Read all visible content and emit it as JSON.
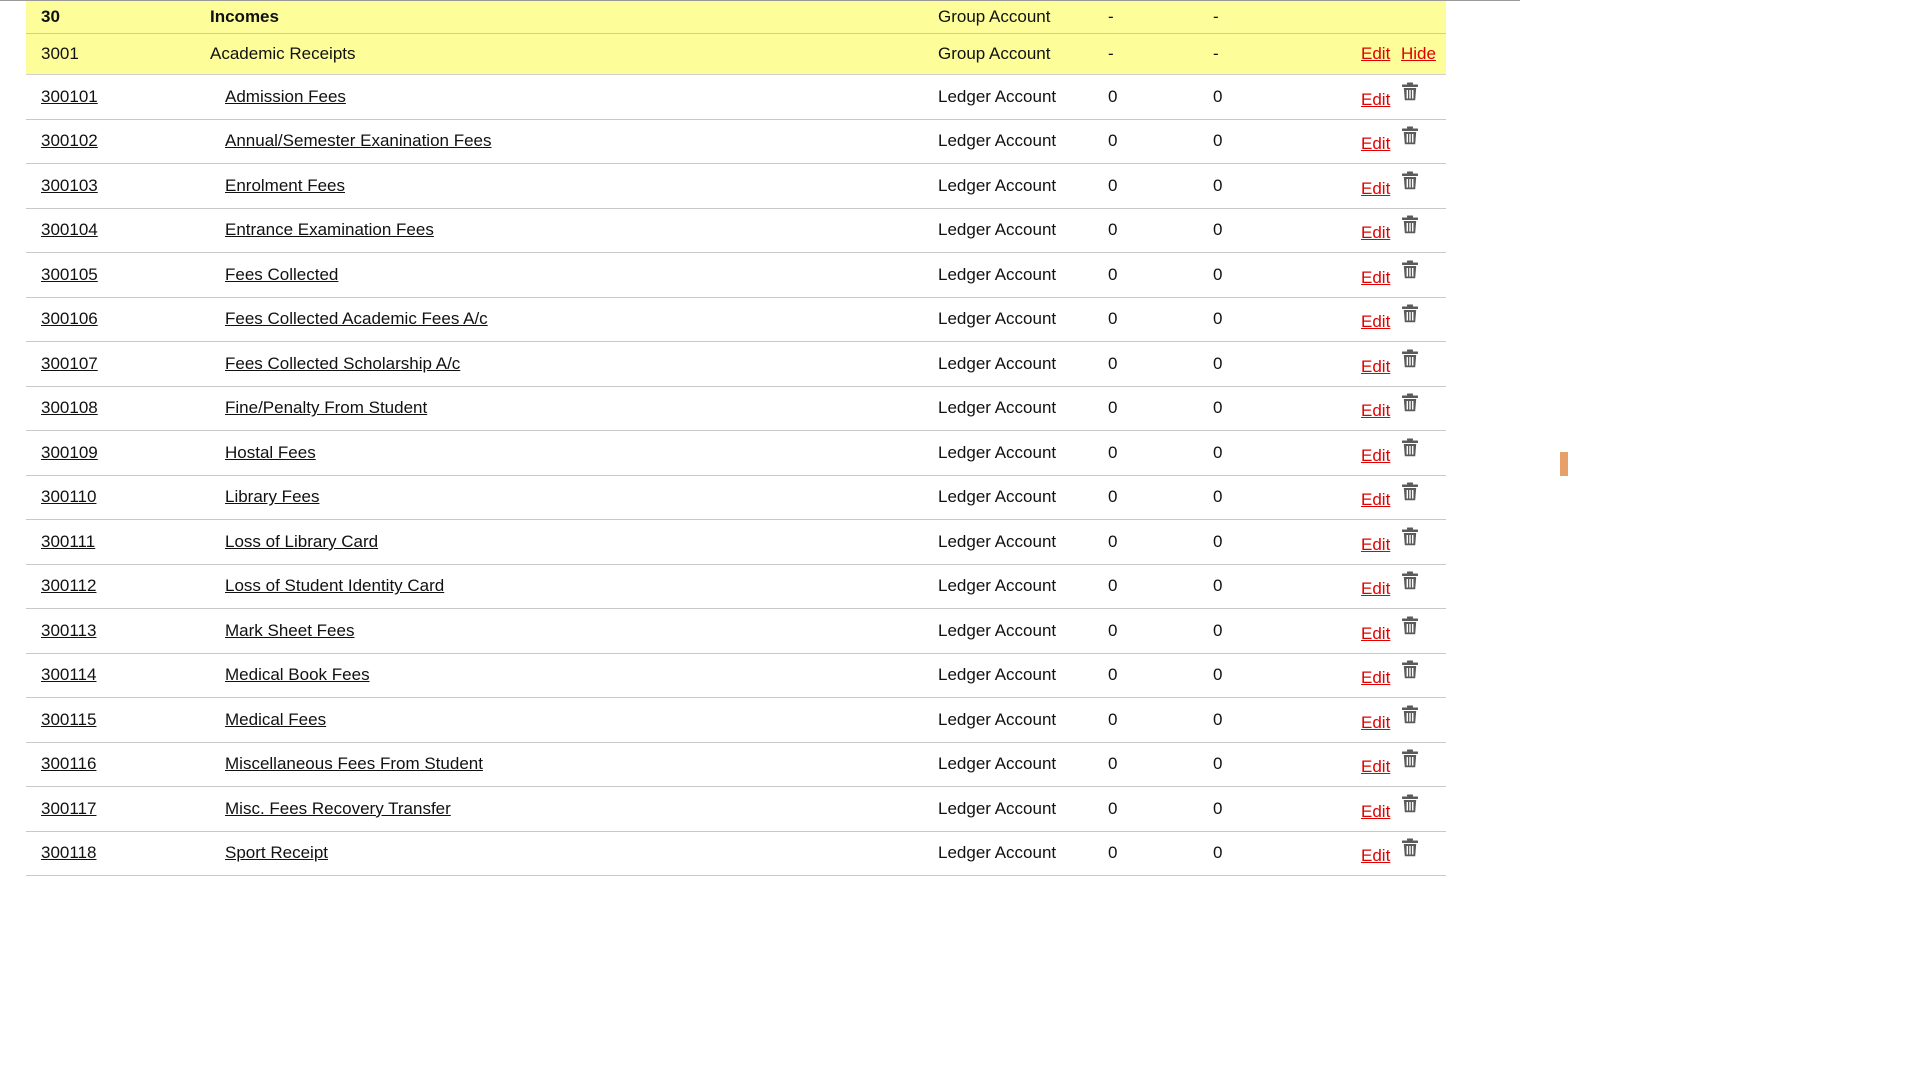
{
  "group_rows": [
    {
      "code": "30",
      "name": "Incomes",
      "type": "Group Account",
      "debit": "-",
      "credit": "-",
      "edit": "",
      "hide": ""
    },
    {
      "code": "3001",
      "name": "Academic Receipts",
      "type": "Group Account",
      "debit": "-",
      "credit": "-",
      "edit": "Edit",
      "hide": "Hide"
    }
  ],
  "ledger_rows": [
    {
      "code": "300101",
      "name": "Admission Fees",
      "type": "Ledger Account",
      "debit": "0",
      "credit": "0",
      "edit": "Edit"
    },
    {
      "code": "300102",
      "name": "Annual/Semester Exanination Fees",
      "type": "Ledger Account",
      "debit": "0",
      "credit": "0",
      "edit": "Edit"
    },
    {
      "code": "300103",
      "name": "Enrolment Fees",
      "type": "Ledger Account",
      "debit": "0",
      "credit": "0",
      "edit": "Edit"
    },
    {
      "code": "300104",
      "name": "Entrance Examination Fees",
      "type": "Ledger Account",
      "debit": "0",
      "credit": "0",
      "edit": "Edit"
    },
    {
      "code": "300105",
      "name": "Fees Collected",
      "type": "Ledger Account",
      "debit": "0",
      "credit": "0",
      "edit": "Edit"
    },
    {
      "code": "300106",
      "name": "Fees Collected Academic Fees A/c",
      "type": "Ledger Account",
      "debit": "0",
      "credit": "0",
      "edit": "Edit"
    },
    {
      "code": "300107",
      "name": "Fees Collected Scholarship A/c",
      "type": "Ledger Account",
      "debit": "0",
      "credit": "0",
      "edit": "Edit"
    },
    {
      "code": "300108",
      "name": "Fine/Penalty From Student",
      "type": "Ledger Account",
      "debit": "0",
      "credit": "0",
      "edit": "Edit"
    },
    {
      "code": "300109",
      "name": "Hostal Fees",
      "type": "Ledger Account",
      "debit": "0",
      "credit": "0",
      "edit": "Edit"
    },
    {
      "code": "300110",
      "name": "Library Fees",
      "type": "Ledger Account",
      "debit": "0",
      "credit": "0",
      "edit": "Edit"
    },
    {
      "code": "300111",
      "name": "Loss of Library Card",
      "type": "Ledger Account",
      "debit": "0",
      "credit": "0",
      "edit": "Edit"
    },
    {
      "code": "300112",
      "name": "Loss of Student Identity Card",
      "type": "Ledger Account",
      "debit": "0",
      "credit": "0",
      "edit": "Edit"
    },
    {
      "code": "300113",
      "name": "Mark Sheet Fees",
      "type": "Ledger Account",
      "debit": "0",
      "credit": "0",
      "edit": "Edit"
    },
    {
      "code": "300114",
      "name": "Medical Book Fees",
      "type": "Ledger Account",
      "debit": "0",
      "credit": "0",
      "edit": "Edit"
    },
    {
      "code": "300115",
      "name": "Medical Fees",
      "type": "Ledger Account",
      "debit": "0",
      "credit": "0",
      "edit": "Edit"
    },
    {
      "code": "300116",
      "name": "Miscellaneous Fees From Student",
      "type": "Ledger Account",
      "debit": "0",
      "credit": "0",
      "edit": "Edit"
    },
    {
      "code": "300117",
      "name": "Misc. Fees Recovery Transfer",
      "type": "Ledger Account",
      "debit": "0",
      "credit": "0",
      "edit": "Edit"
    },
    {
      "code": "300118",
      "name": "Sport Receipt",
      "type": "Ledger Account",
      "debit": "0",
      "credit": "0",
      "edit": "Edit"
    }
  ],
  "icons": {
    "delete": "trash-icon",
    "delete_color": "#5a5a5a"
  },
  "colors": {
    "group_row_bg": "#fdfd9a",
    "action_link": "#e00000",
    "scroll_marker": "#e8a06a"
  }
}
